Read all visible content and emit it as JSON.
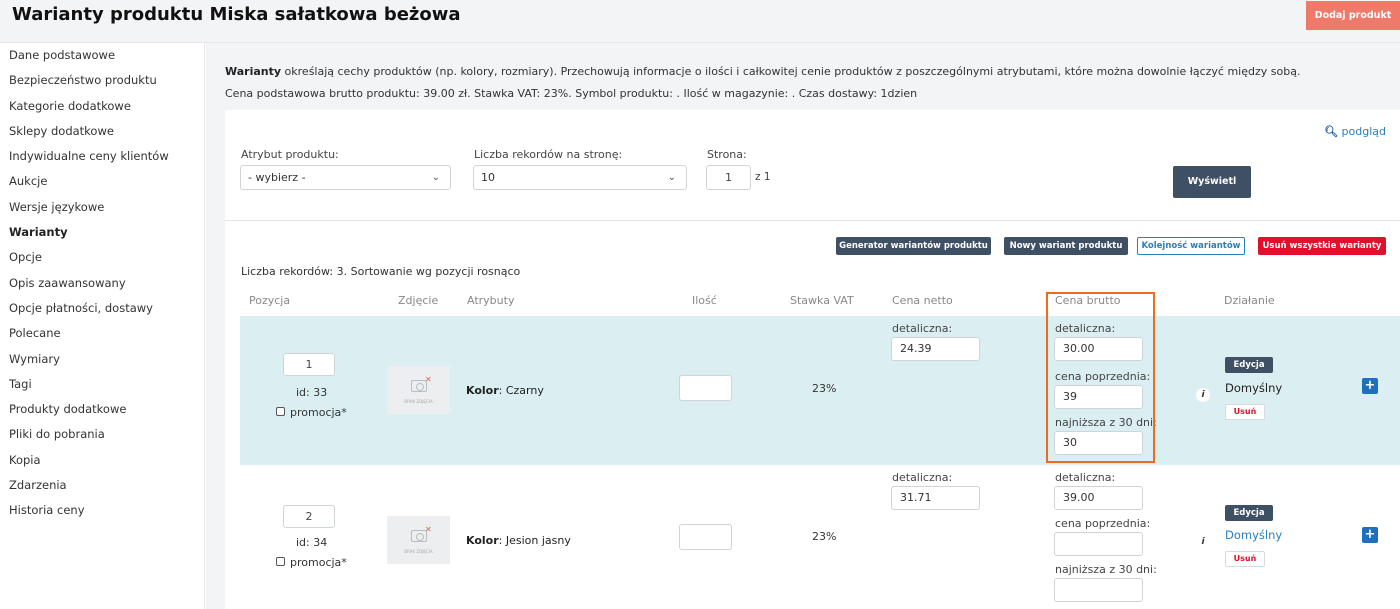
{
  "header": {
    "title": "Warianty produktu Miska sałatkowa beżowa",
    "add_button": "Dodaj produkt"
  },
  "sidebar": {
    "items": [
      {
        "label": "Dane podstawowe"
      },
      {
        "label": "Bezpieczeństwo produktu"
      },
      {
        "label": "Kategorie dodatkowe"
      },
      {
        "label": "Sklepy dodatkowe"
      },
      {
        "label": "Indywidualne ceny klientów"
      },
      {
        "label": "Aukcje"
      },
      {
        "label": "Wersje językowe"
      },
      {
        "label": "Warianty",
        "active": true
      },
      {
        "label": "Opcje"
      },
      {
        "label": "Opis zaawansowany"
      },
      {
        "label": "Opcje płatności, dostawy"
      },
      {
        "label": "Polecane"
      },
      {
        "label": "Wymiary"
      },
      {
        "label": "Tagi"
      },
      {
        "label": "Produkty dodatkowe"
      },
      {
        "label": "Pliki do pobrania"
      },
      {
        "label": "Kopia"
      },
      {
        "label": "Zdarzenia"
      },
      {
        "label": "Historia ceny"
      }
    ]
  },
  "intro": {
    "bold": "Warianty",
    "text": " określają cechy produktów (np. kolory, rozmiary). Przechowują informacje o ilości i całkowitej cenie produktów z poszczególnymi atrybutami, które można dowolnie łączyć między sobą.",
    "summary": "Cena podstawowa brutto produktu: 39.00 zł. Stawka VAT: 23%. Symbol produktu: . Ilość w magazynie: . Czas dostawy: 1dzien"
  },
  "filters": {
    "preview": "podgląd",
    "attribute_label": "Atrybut produktu:",
    "attribute_value": "- wybierz -",
    "per_page_label": "Liczba rekordów na stronę:",
    "per_page_value": "10",
    "page_label": "Strona:",
    "page_value": "1",
    "page_of": "z 1",
    "show_button": "Wyświetl"
  },
  "actions": {
    "generator": "Generator wariantów produktu",
    "new_variant": "Nowy wariant produktu",
    "order": "Kolejność wariantów",
    "delete_all": "Usuń wszystkie warianty"
  },
  "records_info": "Liczba rekordów: 3. Sortowanie wg pozycji rosnąco",
  "columns": {
    "position": "Pozycja",
    "photo": "Zdjęcie",
    "attributes": "Atrybuty",
    "quantity": "Ilość",
    "vat": "Stawka VAT",
    "net": "Cena netto",
    "gross": "Cena brutto",
    "action": "Działanie"
  },
  "rows": [
    {
      "position": "1",
      "id": "id: 33",
      "promo": "promocja*",
      "photo_text": "BRAK ZDJĘCIA",
      "attr_key": "Kolor",
      "attr_value": ": Czarny",
      "quantity": "",
      "vat": "23%",
      "net_label": "detaliczna:",
      "net_value": "24.39",
      "gross_label": "detaliczna:",
      "gross_value": "30.00",
      "prev_label": "cena poprzednia:",
      "prev_value": "39",
      "low_label": "najniższa z 30 dni:",
      "low_value": "30",
      "edit": "Edycja",
      "default": "Domyślny",
      "delete": "Usuń"
    },
    {
      "position": "2",
      "id": "id: 34",
      "promo": "promocja*",
      "photo_text": "BRAK ZDJĘCIA",
      "attr_key": "Kolor",
      "attr_value": ": Jesion jasny",
      "quantity": "",
      "vat": "23%",
      "net_label": "detaliczna:",
      "net_value": "31.71",
      "gross_label": "detaliczna:",
      "gross_value": "39.00",
      "prev_label": "cena poprzednia:",
      "prev_value": "",
      "low_label": "najniższa z 30 dni:",
      "low_value": "",
      "edit": "Edycja",
      "default": "Domyślny",
      "delete": "Usuń"
    }
  ],
  "colors": {
    "accent": "#2a7fbf",
    "dark_button": "#3f4f64",
    "danger": "#e0102a",
    "highlight": "#f06a20",
    "row_highlight": "#dbeff2",
    "add_button": "#f07a6a"
  }
}
